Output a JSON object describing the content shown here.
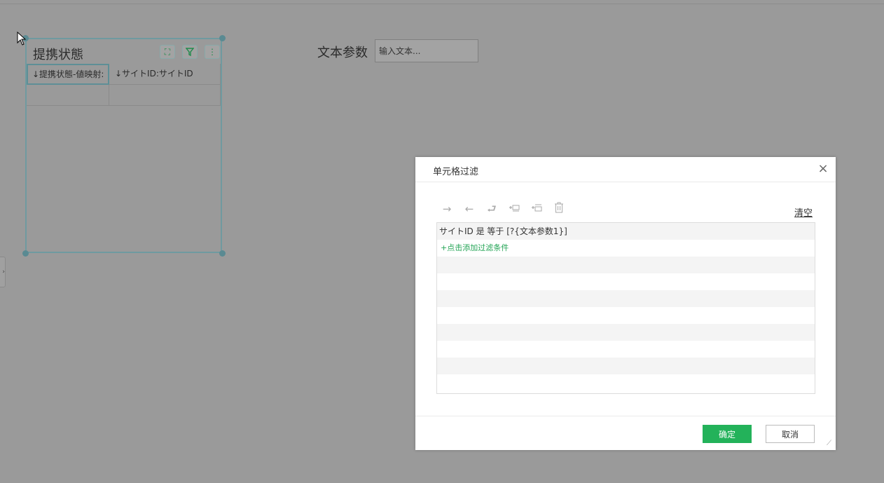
{
  "widget": {
    "title": "提携状態",
    "columns": [
      "↓提携状態-値映射:",
      "↓サイトID:サイトID"
    ],
    "row": [
      "",
      ""
    ]
  },
  "param": {
    "label": "文本参数",
    "placeholder": "输入文本..."
  },
  "dialog": {
    "title": "单元格过滤",
    "close": "×",
    "clear": "清空",
    "condition": "サイトID 是 等于 [?{文本参数1}]",
    "add_condition": "+点击添加过滤条件",
    "ok": "确定",
    "cancel": "取消"
  },
  "colors": {
    "accent": "#23b25a",
    "overlay": "#9a9a9a",
    "selection": "#5e8f96"
  }
}
